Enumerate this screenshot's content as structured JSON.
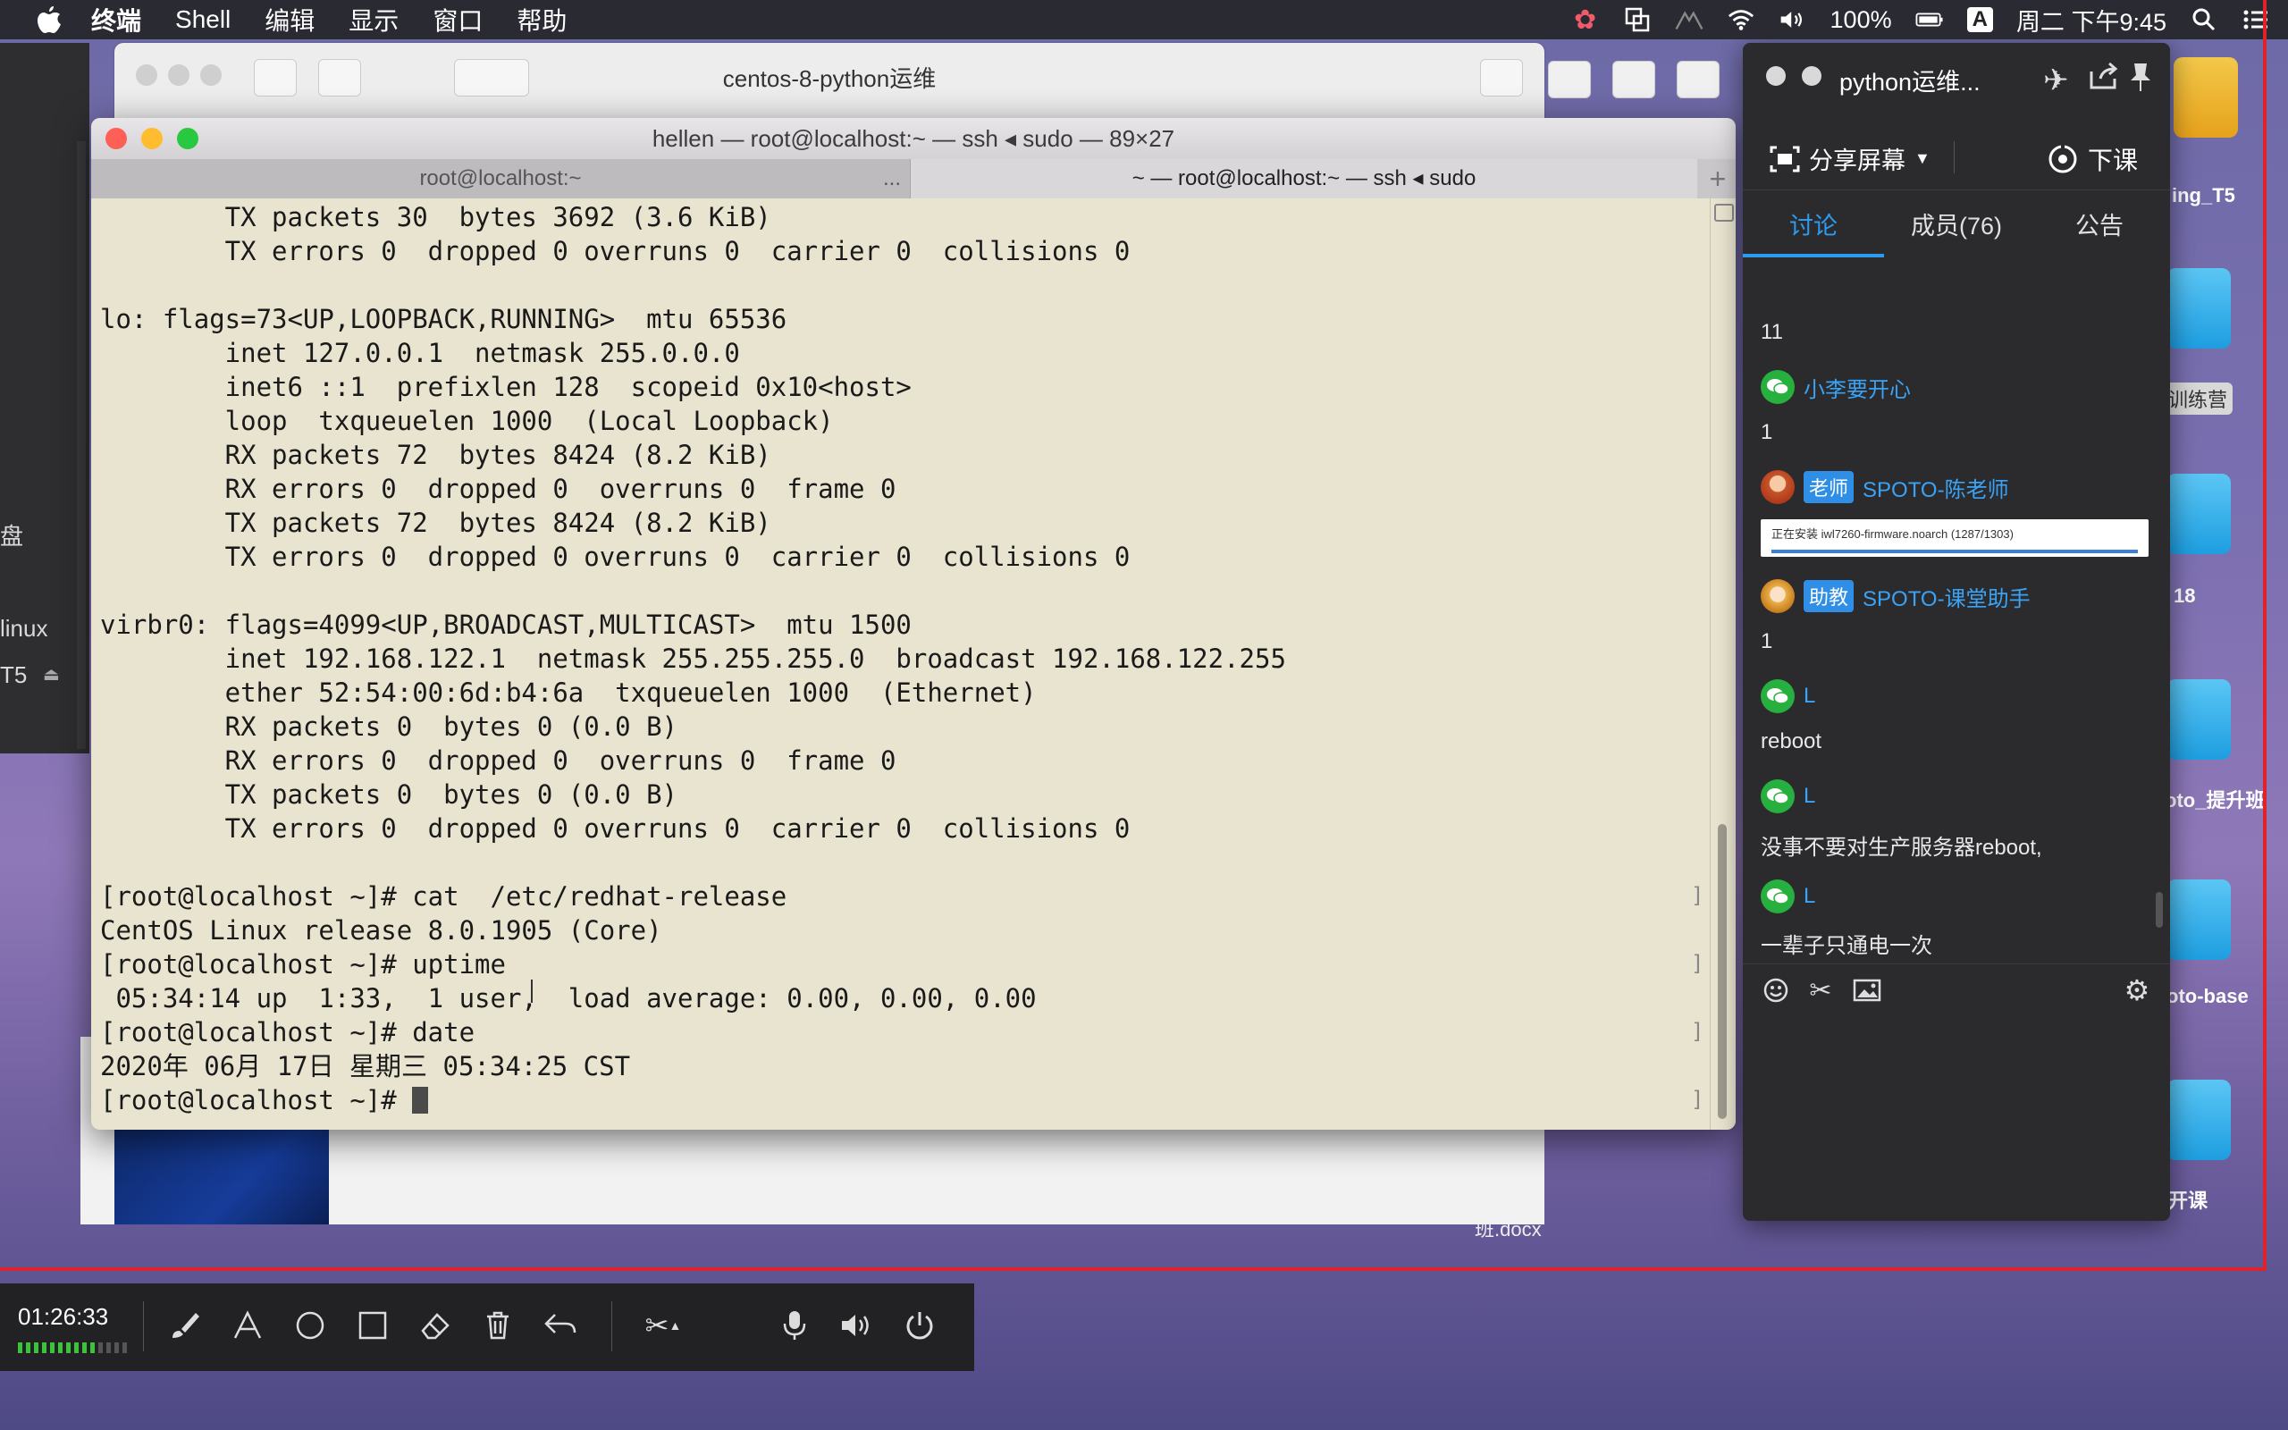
{
  "menubar": {
    "items": [
      "终端",
      "Shell",
      "编辑",
      "显示",
      "窗口",
      "帮助"
    ],
    "battery": "100%",
    "input_method": "A",
    "clock": "周二 下午9:45"
  },
  "desktop": {
    "labels": [
      "ing_T5",
      "训练营",
      "18",
      "oto_提升班",
      "oto-base",
      "开课",
      "班.docx"
    ]
  },
  "left_window": {
    "texts": [
      "盘",
      "linux",
      "T5"
    ]
  },
  "vm_window": {
    "title": "centos-8-python运维"
  },
  "terminal": {
    "title": "hellen — root@localhost:~ — ssh ◂ sudo — 89×27",
    "tabs": [
      "root@localhost:~",
      "~ — root@localhost:~ — ssh ◂ sudo"
    ],
    "tab_overflow": "...",
    "add_tab": "+",
    "lines": [
      "        TX packets 30  bytes 3692 (3.6 KiB)",
      "        TX errors 0  dropped 0 overruns 0  carrier 0  collisions 0",
      "",
      "lo: flags=73<UP,LOOPBACK,RUNNING>  mtu 65536",
      "        inet 127.0.0.1  netmask 255.0.0.0",
      "        inet6 ::1  prefixlen 128  scopeid 0x10<host>",
      "        loop  txqueuelen 1000  (Local Loopback)",
      "        RX packets 72  bytes 8424 (8.2 KiB)",
      "        RX errors 0  dropped 0  overruns 0  frame 0",
      "        TX packets 72  bytes 8424 (8.2 KiB)",
      "        TX errors 0  dropped 0 overruns 0  carrier 0  collisions 0",
      "",
      "virbr0: flags=4099<UP,BROADCAST,MULTICAST>  mtu 1500",
      "        inet 192.168.122.1  netmask 255.255.255.0  broadcast 192.168.122.255",
      "        ether 52:54:00:6d:b4:6a  txqueuelen 1000  (Ethernet)",
      "        RX packets 0  bytes 0 (0.0 B)",
      "        RX errors 0  dropped 0  overruns 0  frame 0",
      "        TX packets 0  bytes 0 (0.0 B)",
      "        TX errors 0  dropped 0 overruns 0  carrier 0  collisions 0",
      "",
      "[root@localhost ~]# cat  /etc/redhat-release",
      "CentOS Linux release 8.0.1905 (Core)",
      "[root@localhost ~]# uptime",
      " 05:34:14 up  1:33,  1 user,  load average: 0.00, 0.00, 0.00",
      "[root@localhost ~]# date",
      "2020年 06月 17日 星期三 05:34:25 CST",
      "[root@localhost ~]# "
    ]
  },
  "chat": {
    "title": "python运维...",
    "share_screen": "分享屏幕",
    "end_class": "下课",
    "tabs": [
      "讨论",
      "成员(76)",
      "公告"
    ],
    "messages": {
      "m0": "11",
      "s1": "小李要开心",
      "m1": "1",
      "s2_badge": "老师",
      "s2": "SPOTO-陈老师",
      "install_text": "正在安装 iwl7260-firmware.noarch (1287/1303)",
      "s3_badge": "助教",
      "s3": "SPOTO-课堂助手",
      "m3": "1",
      "s4": "L",
      "m4": "reboot",
      "s5": "L",
      "m5": "没事不要对生产服务器reboot,",
      "s6": "L",
      "m6": "一辈子只通电一次"
    }
  },
  "recorder": {
    "time": "01:26:33",
    "level": 0.7
  },
  "colors": {
    "accent": "#2d9cf0",
    "wechat_green": "#27b03e",
    "record_red": "#e0232b"
  }
}
